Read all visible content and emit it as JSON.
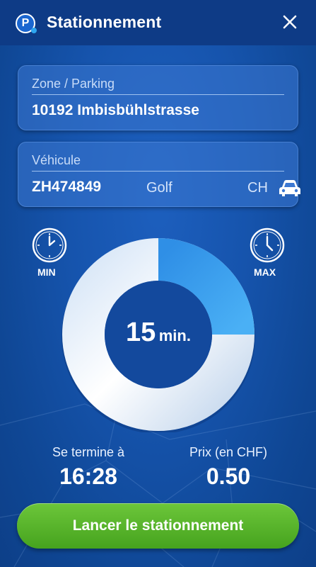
{
  "header": {
    "title": "Stationnement",
    "logo_letter": "P"
  },
  "zone": {
    "label": "Zone / Parking",
    "value": "10192 Imbisbühlstrasse"
  },
  "vehicle": {
    "label": "Véhicule",
    "plate": "ZH474849",
    "model": "Golf",
    "country": "CH"
  },
  "duration": {
    "min_label": "MIN",
    "max_label": "MAX",
    "value": "15",
    "unit": "min.",
    "fill_fraction": 0.25
  },
  "summary": {
    "end_label": "Se termine à",
    "end_time": "16:28",
    "price_label": "Prix (en CHF)",
    "price": "0.50"
  },
  "action": {
    "start_label": "Lancer le stationnement"
  },
  "colors": {
    "header": "#0e3b86",
    "background": "#1654ad",
    "donut_fill": "#3aa0ee",
    "donut_track": "#eef3f8",
    "button": "#52ad27"
  }
}
